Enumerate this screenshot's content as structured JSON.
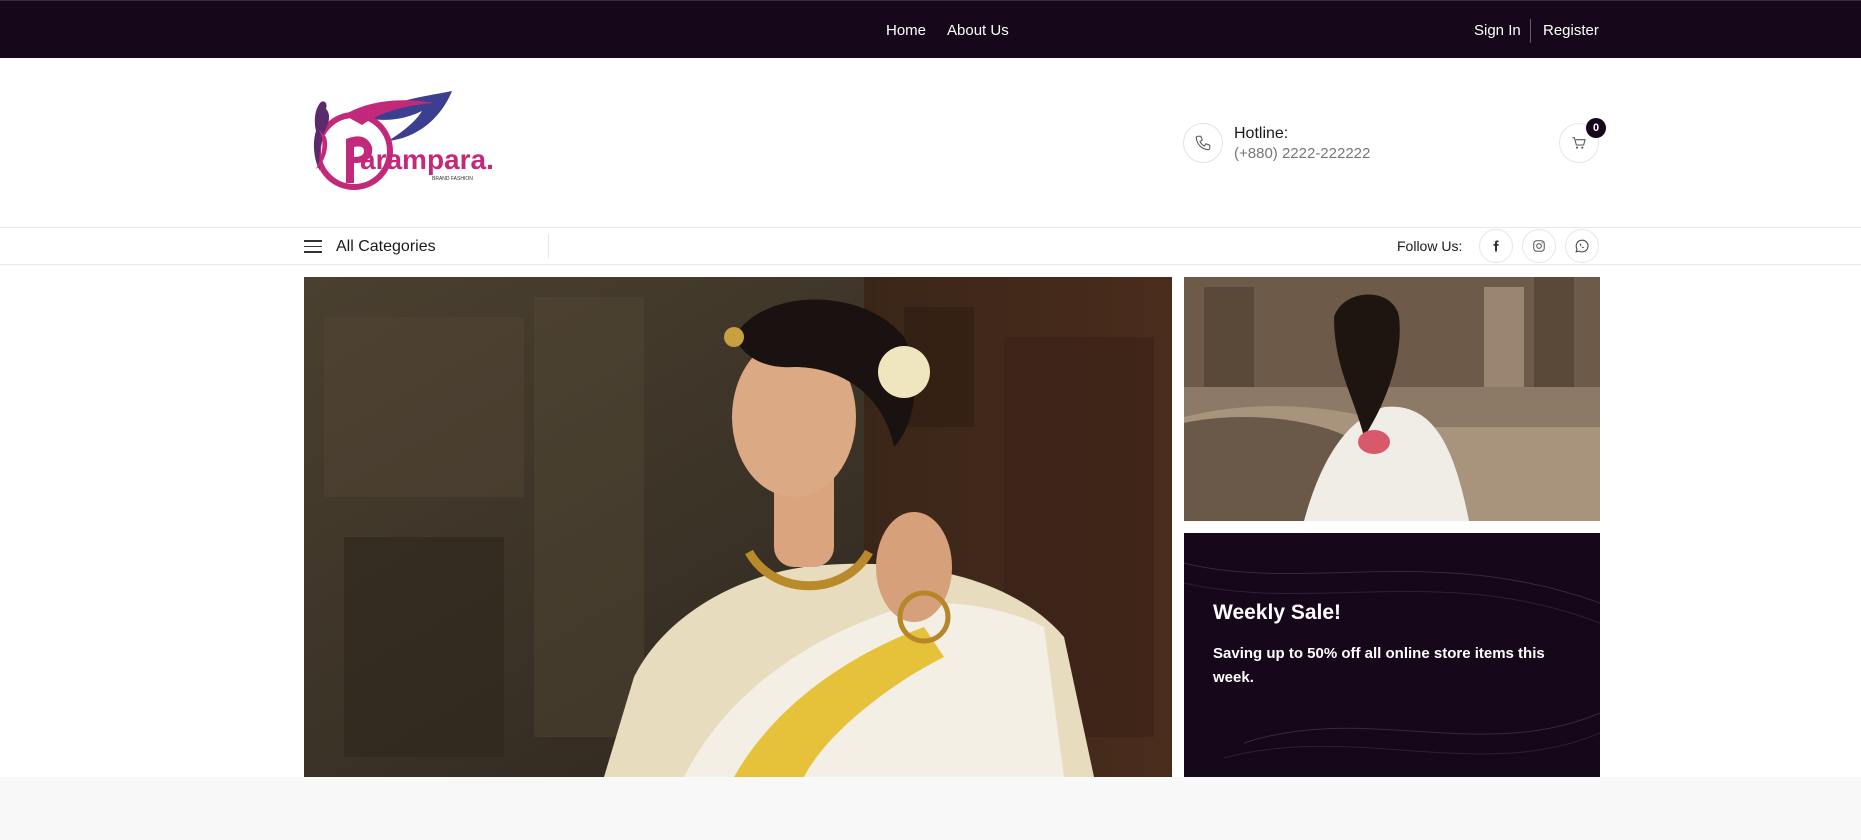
{
  "topbar": {
    "nav": [
      "Home",
      "About Us"
    ],
    "auth": {
      "signin": "Sign In",
      "register": "Register"
    }
  },
  "header": {
    "logo": {
      "brand": "arampara.",
      "tagline": "BRAND FASHION"
    },
    "hotline": {
      "label": "Hotline:",
      "number": "(+880) 2222-222222"
    },
    "cart": {
      "count": "0"
    }
  },
  "category_bar": {
    "all_categories": "All Categories",
    "follow_label": "Follow Us:",
    "social_icons": [
      "facebook-icon",
      "instagram-icon",
      "whatsapp-icon"
    ]
  },
  "promo": {
    "title": "Weekly Sale!",
    "text": "Saving up to 50% off all online store items this week."
  },
  "colors": {
    "dark": "#16071a",
    "brand_pink": "#c2297a",
    "brand_blue": "#3a3f8f"
  }
}
